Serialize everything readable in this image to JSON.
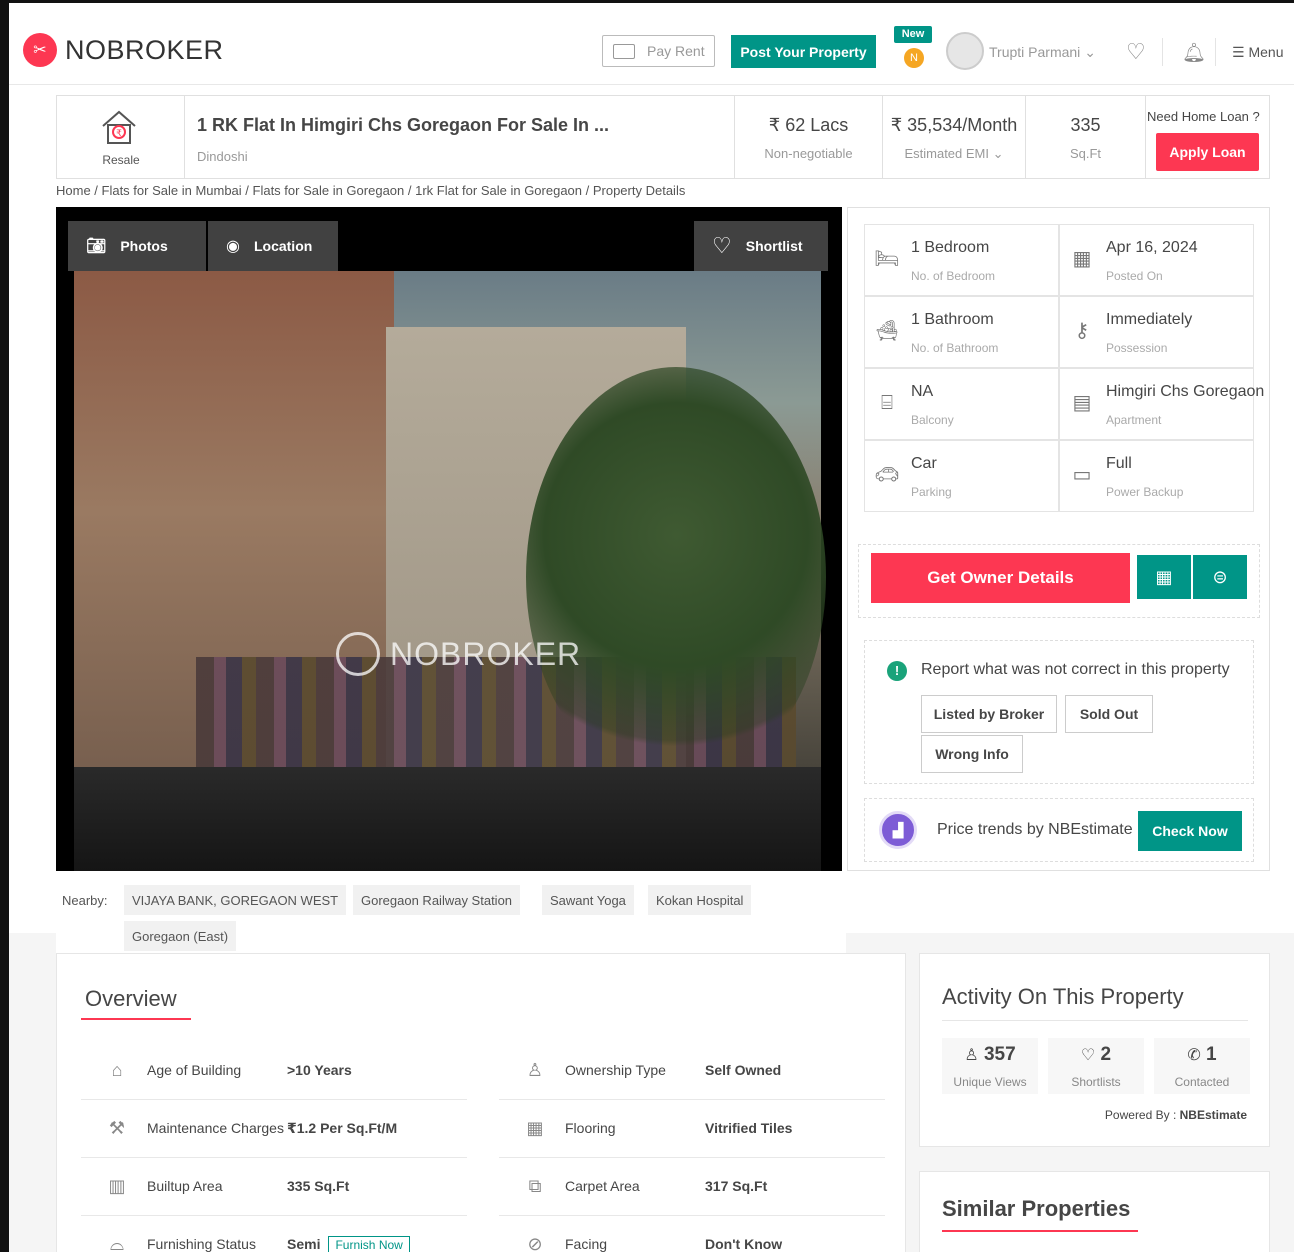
{
  "header": {
    "logo_text": "NOBROKER",
    "pay_rent": "Pay Rent",
    "post_property": "Post Your Property",
    "new_badge": "New",
    "notif_letter": "N",
    "user_name": "Trupti Parmani",
    "menu": "Menu"
  },
  "listing": {
    "type_label": "Resale",
    "title": "1 RK Flat In Himgiri Chs Goregaon For Sale In ...",
    "locality": "Dindoshi",
    "price": "₹ 62 Lacs",
    "price_note": "Non-negotiable",
    "emi": "₹ 35,534/Month",
    "emi_note": "Estimated EMI",
    "area": "335",
    "area_unit": "Sq.Ft",
    "loan_question": "Need Home Loan ?",
    "apply_loan": "Apply Loan"
  },
  "breadcrumb": "Home / Flats for Sale in Mumbai / Flats for Sale in Goregaon / 1rk Flat for Sale in Goregaon / Property Details",
  "photo": {
    "photos_btn": "Photos",
    "location_btn": "Location",
    "shortlist_btn": "Shortlist",
    "watermark": "NOBROKER"
  },
  "details": [
    {
      "value": "1 Bedroom",
      "label": "No. of Bedroom",
      "icon": "bed-icon"
    },
    {
      "value": "Apr 16, 2024",
      "label": "Posted On",
      "icon": "calendar-icon"
    },
    {
      "value": "1 Bathroom",
      "label": "No. of Bathroom",
      "icon": "bathtub-icon"
    },
    {
      "value": "Immediately",
      "label": "Possession",
      "icon": "key-icon"
    },
    {
      "value": "NA",
      "label": "Balcony",
      "icon": "balcony-icon"
    },
    {
      "value": "Himgiri Chs Goregaon",
      "label": "Apartment",
      "icon": "building-icon"
    },
    {
      "value": "Car",
      "label": "Parking",
      "icon": "car-icon"
    },
    {
      "value": "Full",
      "label": "Power Backup",
      "icon": "battery-icon"
    }
  ],
  "actions": {
    "owner_details": "Get Owner Details"
  },
  "report": {
    "title": "Report what was not correct in this property",
    "listed_by_broker": "Listed by Broker",
    "sold_out": "Sold Out",
    "wrong_info": "Wrong Info"
  },
  "trends": {
    "text": "Price trends by NBEstimate",
    "check_now": "Check Now"
  },
  "nearby": {
    "label": "Nearby:",
    "places": [
      "VIJAYA BANK, GOREGAON WEST",
      "Goregaon Railway Station",
      "Sawant Yoga",
      "Kokan Hospital",
      "Goregaon (East)"
    ]
  },
  "overview": {
    "title": "Overview",
    "rows": [
      {
        "label": "Age of Building",
        "value": ">10 Years",
        "icon": "cake-icon"
      },
      {
        "label": "Ownership Type",
        "value": "Self Owned",
        "icon": "person-icon"
      },
      {
        "label": "Maintenance Charges",
        "value": "₹1.2 Per Sq.Ft/M",
        "icon": "tools-icon"
      },
      {
        "label": "Flooring",
        "value": "Vitrified Tiles",
        "icon": "tiles-icon"
      },
      {
        "label": "Builtup Area",
        "value": "335 Sq.Ft",
        "icon": "building-area-icon"
      },
      {
        "label": "Carpet Area",
        "value": "317 Sq.Ft",
        "icon": "carpet-icon"
      },
      {
        "label": "Furnishing Status",
        "value": "Semi",
        "icon": "sofa-icon"
      },
      {
        "label": "Facing",
        "value": "Don't Know",
        "icon": "compass-icon"
      }
    ],
    "furnish_now": "Furnish Now"
  },
  "activity": {
    "title": "Activity On This Property",
    "views": "357",
    "views_label": "Unique Views",
    "shortlists": "2",
    "shortlists_label": "Shortlists",
    "contacted": "1",
    "contacted_label": "Contacted",
    "powered_by": "Powered By :",
    "powered_brand": "NBEstimate"
  },
  "similar": {
    "title": "Similar Properties"
  },
  "colors": {
    "brand_red": "#fd3752",
    "brand_green": "#009587"
  }
}
